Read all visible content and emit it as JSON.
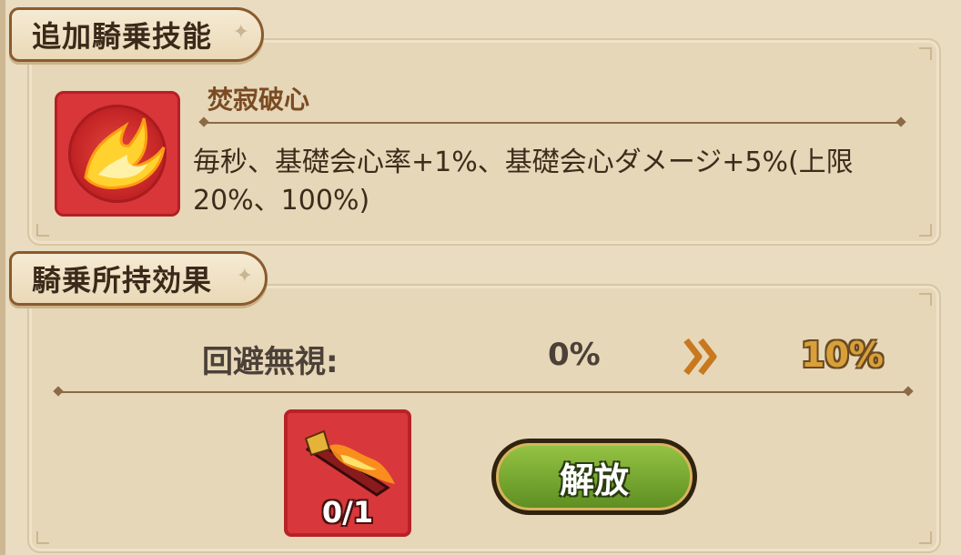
{
  "sections": {
    "mount_skill": {
      "title": "追加騎乗技能"
    },
    "mount_effect": {
      "title": "騎乗所持効果"
    }
  },
  "skill": {
    "name": "焚寂破心",
    "description": "毎秒、基礎会心率+1%、基礎会心ダメージ+5%(上限20%、100%)",
    "icon": "fire-wing-icon"
  },
  "effect": {
    "label": "回避無視:",
    "current": "0%",
    "next": "10%",
    "arrow_icon": "double-chevron-right-icon"
  },
  "item": {
    "icon": "flame-sword-icon",
    "count": "0/1"
  },
  "unlock_button": {
    "label": "解放"
  },
  "colors": {
    "accent_gold": "#d9a03a",
    "button_green": "#6fa12c",
    "slot_red": "#d8383b"
  }
}
